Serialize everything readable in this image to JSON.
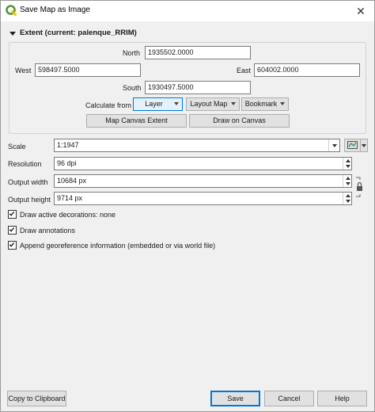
{
  "window": {
    "title": "Save Map as Image",
    "app_icon": "qgis-logo-icon",
    "close_glyph": "✕"
  },
  "extent": {
    "group_title": "Extent (current: palenque_RRIM)",
    "north_label": "North",
    "north_value": "1935502.0000",
    "west_label": "West",
    "west_value": "598497.5000",
    "east_label": "East",
    "east_value": "604002.0000",
    "south_label": "South",
    "south_value": "1930497.5000",
    "calculate_from_label": "Calculate from",
    "layer_button": "Layer",
    "layout_map_button": "Layout Map",
    "bookmark_button": "Bookmark",
    "map_canvas_extent_button": "Map Canvas Extent",
    "draw_on_canvas_button": "Draw on Canvas"
  },
  "settings": {
    "scale_label": "Scale",
    "scale_value": "1:1947",
    "resolution_label": "Resolution",
    "resolution_value": "96 dpi",
    "output_width_label": "Output width",
    "output_width_value": "10684 px",
    "output_height_label": "Output height",
    "output_height_value": "9714 px"
  },
  "options": [
    {
      "label": "Draw active decorations: none",
      "checked": true
    },
    {
      "label": "Draw annotations",
      "checked": true
    },
    {
      "label": "Append georeference information (embedded or via world file)",
      "checked": true
    }
  ],
  "buttons": {
    "copy_clipboard": "Copy to Clipboard",
    "save": "Save",
    "cancel": "Cancel",
    "help": "Help"
  },
  "colors": {
    "accent": "#0078d7",
    "qgis_green": "#589632",
    "qgis_yellow": "#eebf1c"
  }
}
